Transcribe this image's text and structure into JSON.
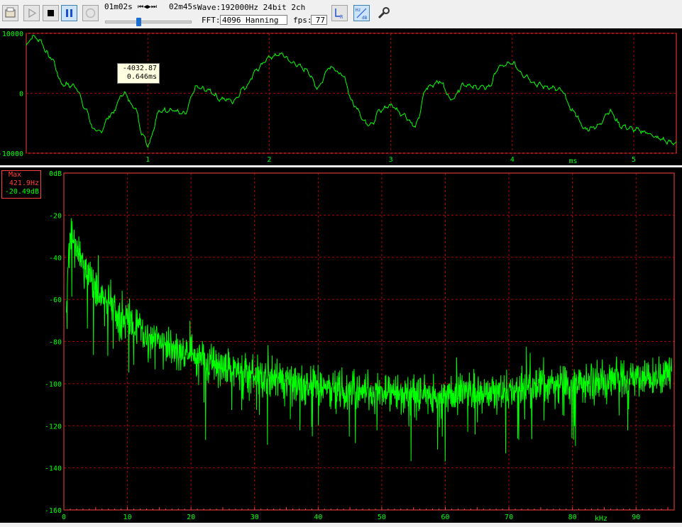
{
  "toolbar": {
    "time_current": "01m02s",
    "time_total": "02m45s",
    "transport_glyphs": "⏮◀▶⏭",
    "wave_label": "Wave:",
    "wave_info": "192000Hz 24bit 2ch",
    "fft_label": "FFT:",
    "fft_value": "4096 Hanning",
    "fps_label": "fps:",
    "fps_value": "77",
    "seek_position": 0.37
  },
  "colors": {
    "trace": "#00ff00",
    "grid": "#b00000",
    "axis_text": "#00ff00",
    "plot_border": "#ff4040",
    "background": "#000000"
  },
  "waveform": {
    "ylim": [
      -10000,
      10000
    ],
    "y_ticks": [
      {
        "v": 10000,
        "label": "10000"
      },
      {
        "v": 0,
        "label": "0"
      },
      {
        "v": -10000,
        "label": "-10000"
      }
    ],
    "xlim": [
      0,
      5.35
    ],
    "x_ticks": [
      {
        "v": 1,
        "label": "1"
      },
      {
        "v": 2,
        "label": "2"
      },
      {
        "v": 3,
        "label": "3"
      },
      {
        "v": 4,
        "label": "4"
      },
      {
        "v": 5,
        "label": "5"
      }
    ],
    "x_unit": "ms",
    "cursor_value": "-4032.87",
    "cursor_time": "0.646ms"
  },
  "spectrum": {
    "ylim": [
      -160,
      0
    ],
    "y_ticks": [
      {
        "v": 0,
        "label": "0dB"
      },
      {
        "v": -20,
        "label": "-20"
      },
      {
        "v": -40,
        "label": "-40"
      },
      {
        "v": -60,
        "label": "-60"
      },
      {
        "v": -80,
        "label": "-80"
      },
      {
        "v": -100,
        "label": "-100"
      },
      {
        "v": -120,
        "label": "-120"
      },
      {
        "v": -140,
        "label": "-140"
      },
      {
        "v": -160,
        "label": "-160"
      }
    ],
    "xlim": [
      0,
      96
    ],
    "x_ticks": [
      {
        "v": 0,
        "label": "0"
      },
      {
        "v": 10,
        "label": "10"
      },
      {
        "v": 20,
        "label": "20"
      },
      {
        "v": 30,
        "label": "30"
      },
      {
        "v": 40,
        "label": "40"
      },
      {
        "v": 50,
        "label": "50"
      },
      {
        "v": 60,
        "label": "60"
      },
      {
        "v": 70,
        "label": "70"
      },
      {
        "v": 80,
        "label": "80"
      },
      {
        "v": 90,
        "label": "90"
      }
    ],
    "x_unit": "kHz",
    "max_label": "Max",
    "max_freq": "421.9Hz",
    "max_db": "-20.49dB"
  },
  "chart_data": [
    {
      "type": "line",
      "xlabel": "ms",
      "ylabel": "",
      "xlim": [
        0,
        5.35
      ],
      "ylim": [
        -10000,
        10000
      ],
      "grid": true,
      "x": [
        0.0,
        0.05,
        0.1,
        0.2,
        0.3,
        0.4,
        0.5,
        0.55,
        0.6,
        0.7,
        0.8,
        0.9,
        0.95,
        1.0,
        1.1,
        1.15,
        1.2,
        1.3,
        1.4,
        1.5,
        1.6,
        1.65,
        1.7,
        1.8,
        1.9,
        2.0,
        2.1,
        2.2,
        2.3,
        2.4,
        2.5,
        2.6,
        2.7,
        2.8,
        2.85,
        2.9,
        3.0,
        3.1,
        3.2,
        3.3,
        3.4,
        3.5,
        3.6,
        3.7,
        3.8,
        3.9,
        4.0,
        4.1,
        4.2,
        4.3,
        4.4,
        4.5,
        4.6,
        4.7,
        4.8,
        4.9,
        5.0,
        5.1,
        5.2,
        5.3,
        5.35
      ],
      "y": [
        8000,
        9500,
        9000,
        6000,
        1500,
        1200,
        -3000,
        -6000,
        -6500,
        -3500,
        0,
        -2500,
        -6500,
        -8500,
        -3000,
        -2800,
        -2800,
        -3500,
        1000,
        500,
        -1000,
        -1000,
        -1300,
        1000,
        4000,
        6000,
        6500,
        5000,
        4000,
        1000,
        4500,
        3000,
        -2000,
        -5000,
        -5000,
        -3000,
        -2000,
        -3500,
        -5500,
        1000,
        2000,
        -1000,
        1500,
        1000,
        1000,
        4500,
        5000,
        3000,
        1500,
        1000,
        500,
        -3000,
        -6000,
        -5500,
        -3000,
        -5500,
        -6000,
        -6500,
        -7500,
        -8200,
        -8300
      ]
    },
    {
      "type": "line",
      "xlabel": "kHz",
      "ylabel": "dB",
      "xlim": [
        0,
        96
      ],
      "ylim": [
        -160,
        0
      ],
      "grid": true,
      "x": [
        0.4,
        1,
        2,
        3,
        4,
        5,
        6,
        7,
        8,
        10,
        12,
        15,
        18,
        20,
        22,
        25,
        28,
        30,
        32,
        35,
        40,
        45,
        50,
        55,
        60,
        65,
        68,
        70,
        75,
        80,
        85,
        90,
        95
      ],
      "y": [
        -58,
        -30,
        -35,
        -42,
        -50,
        -55,
        -60,
        -60,
        -65,
        -70,
        -75,
        -80,
        -84,
        -86,
        -90,
        -93,
        -95,
        -97,
        -98,
        -99,
        -101,
        -103,
        -104,
        -105,
        -105,
        -104,
        -104,
        -103,
        -101,
        -100,
        -98,
        -97,
        -96
      ]
    }
  ]
}
